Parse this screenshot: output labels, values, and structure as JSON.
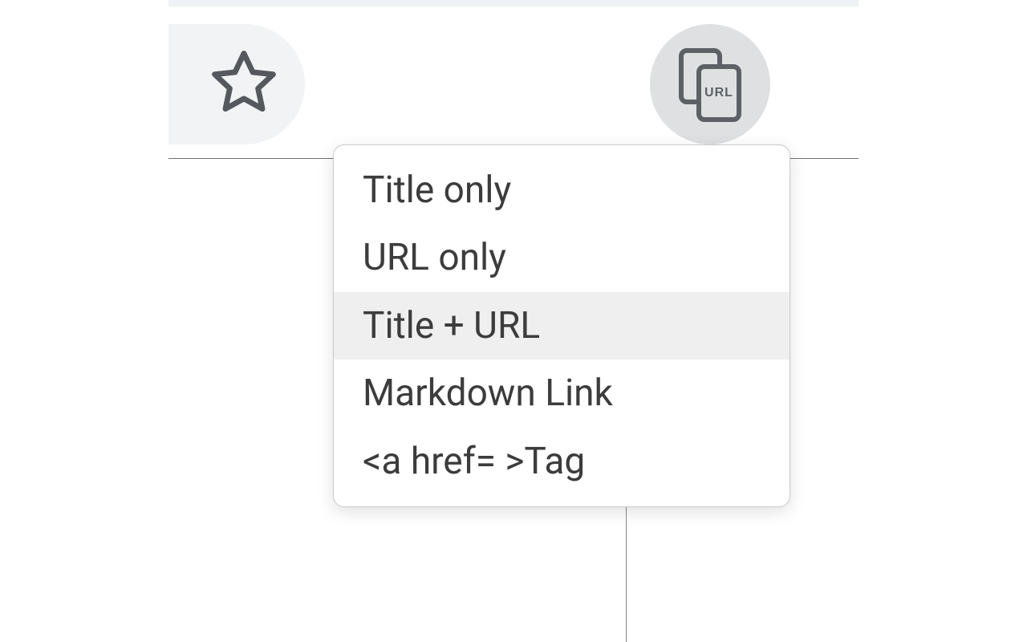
{
  "toolbar": {
    "star_label": "bookmark",
    "ext_label": "copy-url"
  },
  "icon_text": {
    "url_badge": "URL"
  },
  "menu": {
    "items": [
      {
        "label": "Title only",
        "highlighted": false
      },
      {
        "label": "URL only",
        "highlighted": false
      },
      {
        "label": "Title + URL",
        "highlighted": true
      },
      {
        "label": "Markdown Link",
        "highlighted": false
      },
      {
        "label": "<a href= >Tag",
        "highlighted": false
      }
    ]
  }
}
